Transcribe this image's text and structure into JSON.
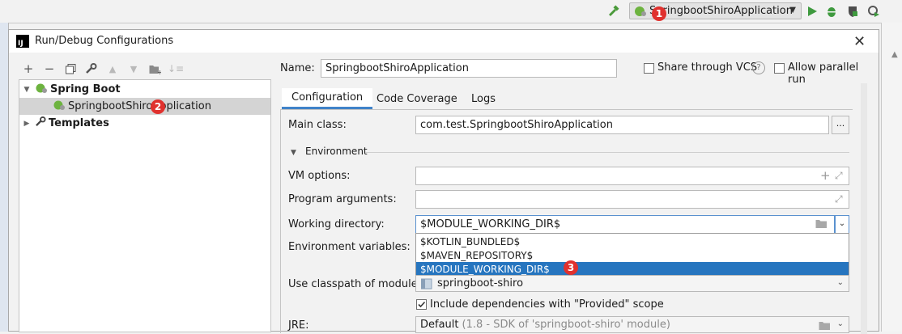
{
  "toolbar": {
    "run_config": "SpringbootShiroApplication"
  },
  "dialog": {
    "title": "Run/Debug Configurations",
    "name_label": "Name:",
    "name_value": "SpringbootShiroApplication",
    "share_label": "Share through VCS",
    "parallel_label": "Allow parallel run"
  },
  "tree": {
    "items": [
      {
        "label": "Spring Boot"
      },
      {
        "label": "SpringbootShiroApplication"
      },
      {
        "label": "Templates"
      }
    ]
  },
  "tabs": [
    {
      "label": "Configuration"
    },
    {
      "label": "Code Coverage"
    },
    {
      "label": "Logs"
    }
  ],
  "form": {
    "main_class_label": "Main class:",
    "main_class_value": "com.test.SpringbootShiroApplication",
    "ellipsis": "...",
    "environment_label": "Environment",
    "vm_options_label": "VM options:",
    "program_args_label": "Program arguments:",
    "working_dir_label": "Working directory:",
    "working_dir_value": "$MODULE_WORKING_DIR$",
    "env_vars_label": "Environment variables:",
    "classpath_label": "Use classpath of module:",
    "classpath_value": "springboot-shiro",
    "include_deps_label": "Include dependencies with \"Provided\" scope",
    "jre_label": "JRE:",
    "jre_value": "Default",
    "jre_detail": "(1.8 - SDK of 'springboot-shiro' module)"
  },
  "dropdown": {
    "options": [
      "$KOTLIN_BUNDLED$",
      "$MAVEN_REPOSITORY$",
      "$MODULE_WORKING_DIR$"
    ]
  },
  "badges": [
    "1",
    "2",
    "3"
  ],
  "colors": {
    "accent": "#2675bf",
    "badge": "#e0312e",
    "tab_underline": "#4083c9",
    "spring_green": "#6db33f"
  }
}
